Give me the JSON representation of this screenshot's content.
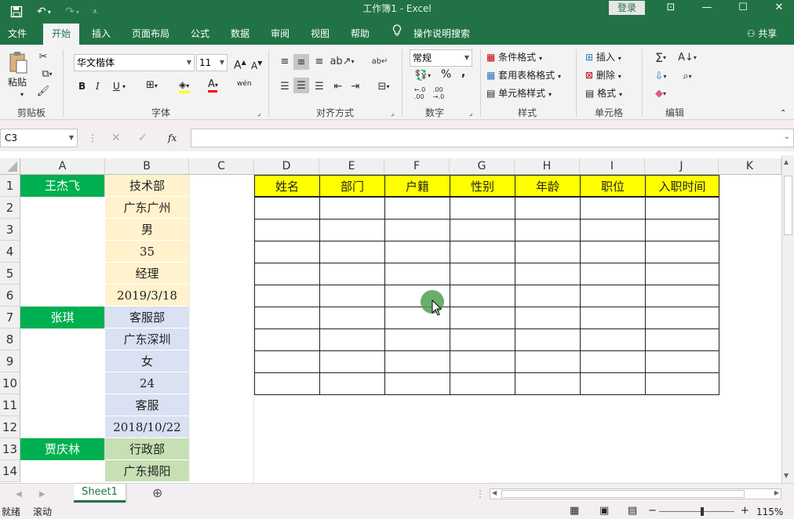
{
  "titlebar": {
    "title": "工作簿1  -  Excel",
    "login": "登录"
  },
  "tabs": [
    "文件",
    "开始",
    "插入",
    "页面布局",
    "公式",
    "数据",
    "审阅",
    "视图",
    "帮助"
  ],
  "tell_me": "操作说明搜索",
  "share": "共享",
  "ribbon": {
    "clipboard": {
      "paste": "粘贴",
      "label": "剪贴板"
    },
    "font": {
      "name": "华文楷体",
      "size": "11",
      "label": "字体",
      "grow": "A",
      "shrink": "A",
      "bold": "B",
      "italic": "I",
      "underline": "U",
      "fontcolor": "A",
      "wen": "wén"
    },
    "alignment": {
      "label": "对齐方式"
    },
    "number": {
      "format": "常规",
      "label": "数字",
      "percent": "%",
      "comma": ","
    },
    "styles": {
      "conditional": "条件格式",
      "table": "套用表格格式",
      "cell": "单元格样式",
      "label": "样式"
    },
    "cells": {
      "insert": "插入",
      "delete": "删除",
      "format": "格式",
      "label": "单元格"
    },
    "editing": {
      "label": "编辑"
    }
  },
  "formula_bar": {
    "name_box": "C3",
    "fx": "fx",
    "value": ""
  },
  "columns": [
    "A",
    "B",
    "C",
    "D",
    "E",
    "F",
    "G",
    "H",
    "I",
    "J",
    "K"
  ],
  "rows": [
    "1",
    "2",
    "3",
    "4",
    "5",
    "6",
    "7",
    "8",
    "9",
    "10",
    "11",
    "12",
    "13",
    "14"
  ],
  "cells": {
    "A1": "王杰飞",
    "A7": "张琪",
    "A13": "贾庆林",
    "B1": "技术部",
    "B2": "广东广州",
    "B3": "男",
    "B4": "35",
    "B5": "经理",
    "B6": "2019/3/18",
    "B7": "客服部",
    "B8": "广东深圳",
    "B9": "女",
    "B10": "24",
    "B11": "客服",
    "B12": "2018/10/22",
    "B13": "行政部",
    "B14": "广东揭阳"
  },
  "table_headers": [
    "姓名",
    "部门",
    "户籍",
    "性别",
    "年龄",
    "职位",
    "入职时间"
  ],
  "colors": {
    "excel_green": "#217346",
    "name_fill": "#00b050",
    "group1_fill": "#fff2cc",
    "group2_fill": "#d9e1f2",
    "group3_fill": "#c6e0b4",
    "header_fill": "#ffff00"
  },
  "sheet_tab": "Sheet1",
  "status": {
    "ready": "就绪",
    "scroll": "滚动",
    "zoom": "115%"
  }
}
